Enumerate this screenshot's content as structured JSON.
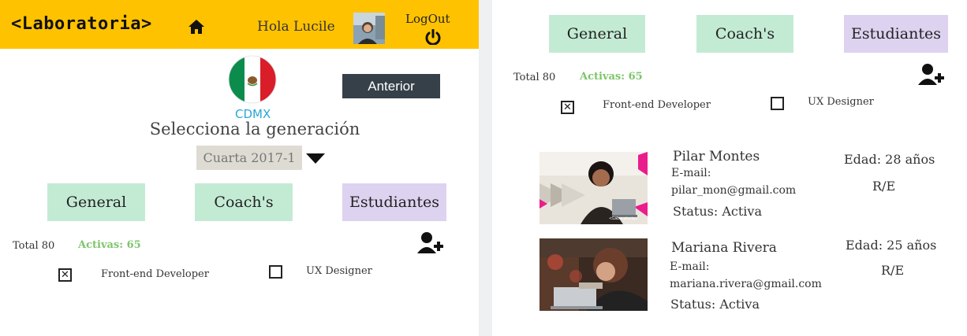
{
  "header": {
    "logo": "<Laboratoria>",
    "greeting": "Hola Lucile",
    "logout_label": "LogOut"
  },
  "sede": {
    "city": "CDMX",
    "back_button": "Anterior",
    "select_title": "Selecciona la generación",
    "selected_generation": "Cuarta 2017-1"
  },
  "tabs": {
    "general": "General",
    "coaches": "Coach's",
    "students": "Estudiantes"
  },
  "summary": {
    "total": "Total 80",
    "active": "Activas: 65"
  },
  "filters": {
    "frontend": "Front-end Developer",
    "frontend_checked": true,
    "ux": "UX Designer",
    "ux_checked": false
  },
  "students": [
    {
      "name": "Pilar Montes",
      "email_label": "E-mail:",
      "email": "pilar_mon@gmail.com",
      "status": "Status: Activa",
      "age": "Edad: 28 años",
      "track": "R/E"
    },
    {
      "name": "Mariana Rivera",
      "email_label": "E-mail:",
      "email": "mariana.rivera@gmail.com",
      "status": "Status: Activa",
      "age": "Edad: 25 años",
      "track": "R/E"
    }
  ],
  "photo_caption": "<Laboratoria>",
  "colors": {
    "header_bg": "#ffc200",
    "tab_green": "#c3ebd4",
    "tab_purple": "#ddd3f0",
    "active_green": "#7dc56a",
    "city_blue": "#2aa6d8",
    "button_dark": "#364049"
  },
  "icons": [
    "home-icon",
    "power-icon",
    "add-user-icon",
    "caret-down-icon",
    "mexico-flag-icon"
  ]
}
